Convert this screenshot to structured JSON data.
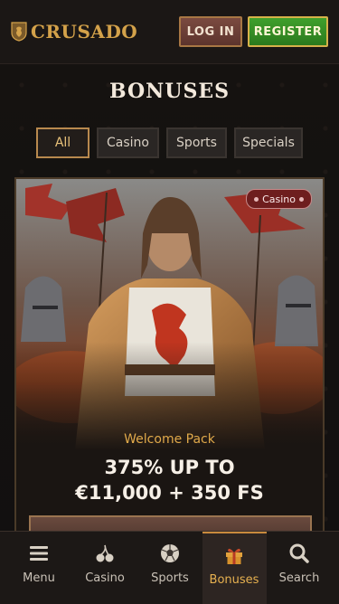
{
  "header": {
    "logo_text": "CRUSADO",
    "login_label": "LOG IN",
    "register_label": "REGISTER"
  },
  "page": {
    "title": "BONUSES"
  },
  "filters": [
    {
      "label": "All",
      "active": true
    },
    {
      "label": "Casino",
      "active": false
    },
    {
      "label": "Sports",
      "active": false
    },
    {
      "label": "Specials",
      "active": false
    }
  ],
  "bonus_card": {
    "tag": "Casino",
    "subtitle": "Welcome Pack",
    "headline_line1": "375% UP TO",
    "headline_line2": "€11,000 + 350 FS"
  },
  "bottom_nav": [
    {
      "label": "Menu",
      "icon": "menu-icon",
      "active": false
    },
    {
      "label": "Casino",
      "icon": "cherries-icon",
      "active": false
    },
    {
      "label": "Sports",
      "icon": "soccer-ball-icon",
      "active": false
    },
    {
      "label": "Bonuses",
      "icon": "gift-icon",
      "active": true
    },
    {
      "label": "Search",
      "icon": "search-icon",
      "active": false
    }
  ],
  "colors": {
    "accent_gold": "#d4a24a",
    "register_green": "#3fa02c",
    "login_brown": "#7b4a40",
    "casino_tag_red": "#6e1e1e"
  }
}
